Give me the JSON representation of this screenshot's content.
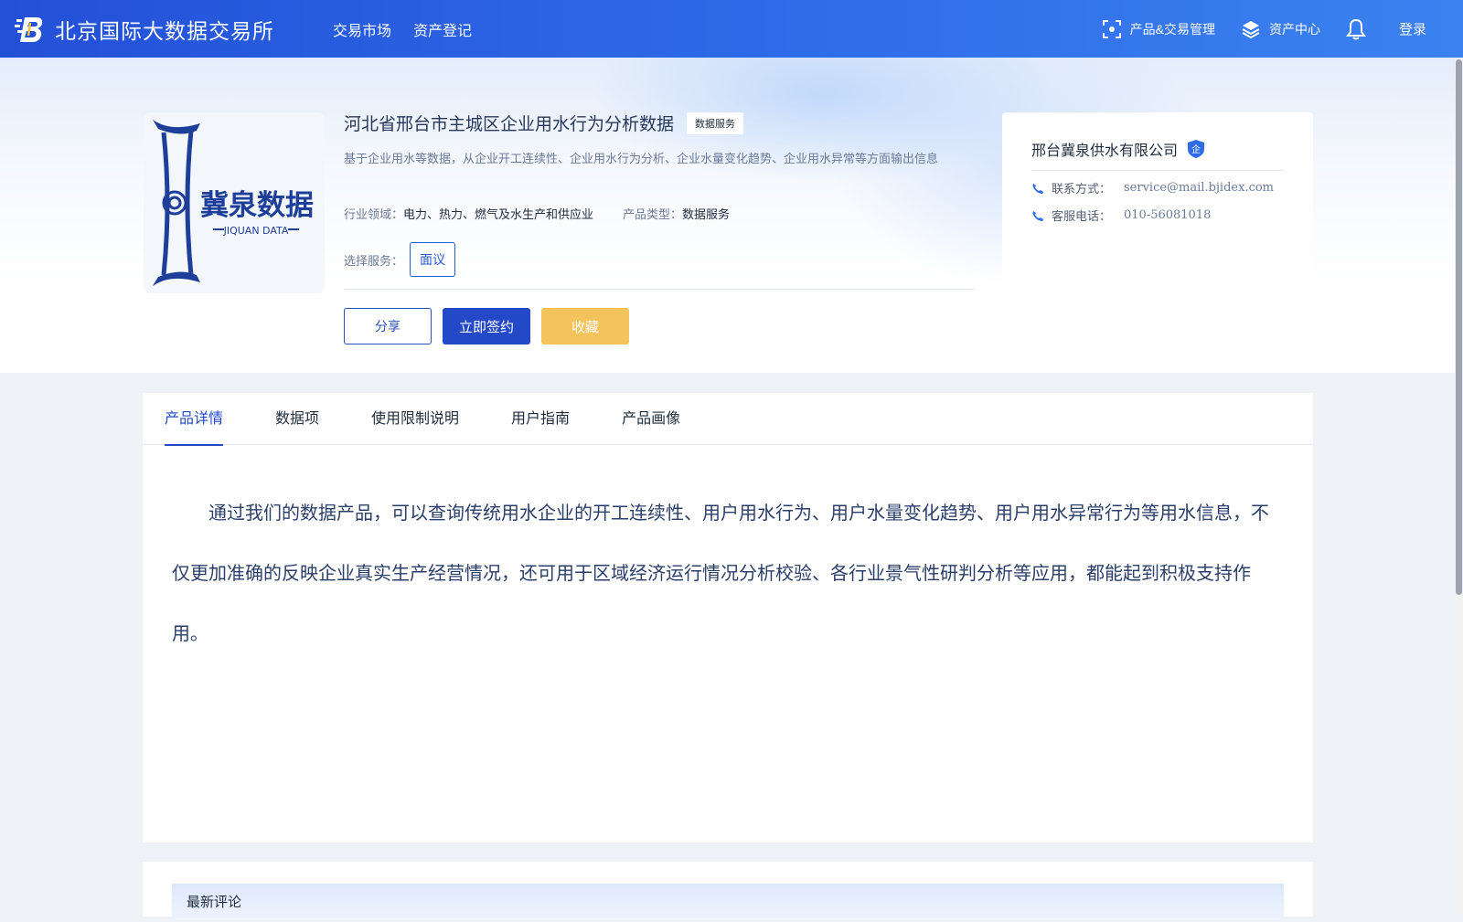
{
  "header": {
    "site_name": "北京国际大数据交易所",
    "nav": [
      "交易市场",
      "资产登记"
    ],
    "product_trade": "产品&交易管理",
    "asset_center": "资产中心",
    "login": "登录"
  },
  "product": {
    "logo_cn": "冀泉数据",
    "logo_en": "JIQUAN DATA",
    "title": "河北省邢台市主城区企业用水行为分析数据",
    "type_tag": "数据服务",
    "description": "基于企业用水等数据，从企业开工连续性、企业用水行为分析、企业水量变化趋势、企业用水异常等方面输出信息",
    "industry_label": "行业领域：",
    "industry_value": "电力、热力、燃气及水生产和供应业",
    "product_type_label": "产品类型：",
    "product_type_value": "数据服务",
    "service_label": "选择服务：",
    "service_option": "面议",
    "buttons": {
      "share": "分享",
      "sign": "立即签约",
      "favorite": "收藏"
    }
  },
  "company": {
    "name": "邢台冀泉供水有限公司",
    "badge": "企",
    "contact_label": "联系方式：",
    "contact_value": "service@mail.bjidex.com",
    "phone_label": "客服电话：",
    "phone_value": "010-56081018"
  },
  "tabs": [
    "产品详情",
    "数据项",
    "使用限制说明",
    "用户指南",
    "产品画像"
  ],
  "active_tab": 0,
  "detail_text": "通过我们的数据产品，可以查询传统用水企业的开工连续性、用户用水行为、用户水量变化趋势、用户用水异常行为等用水信息，不仅更加准确的反映企业真实生产经营情况，还可用于区域经济运行情况分析校验、各行业景气性研判分析等应用，都能起到积极支持作用。",
  "comments": {
    "title": "最新评论"
  },
  "colors": {
    "header": "#2f6ce8",
    "primary": "#2349c9",
    "favorite": "#f5c35c"
  }
}
